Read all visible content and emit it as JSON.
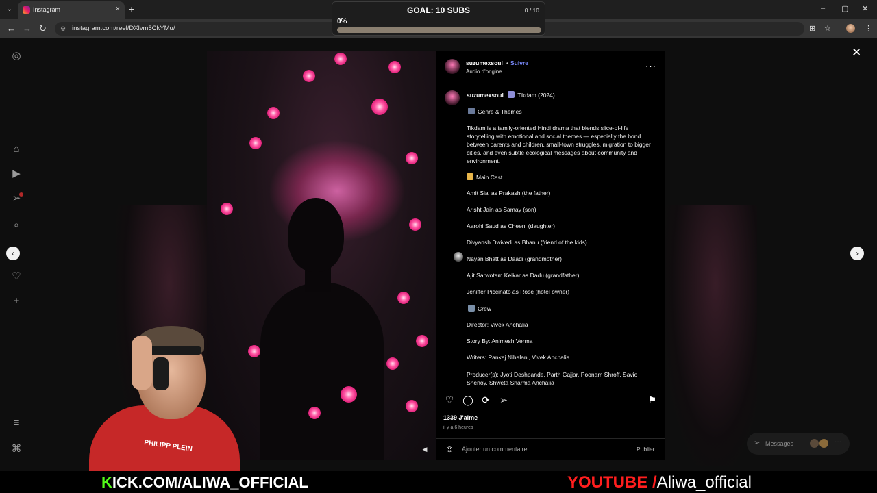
{
  "browser": {
    "tab_title": "Instagram",
    "tab_close": "×",
    "new_tab": "+",
    "url": "instagram.com/reel/DXlvm5CkYMu/",
    "window_controls": {
      "minimize": "–",
      "maximize": "▢",
      "close": "✕"
    }
  },
  "goal_widget": {
    "title": "GOAL: 10 SUBS",
    "count": "0 / 10",
    "percent_label": "0%",
    "progress": 0.0
  },
  "post": {
    "username": "suzumexsoul",
    "follow_label": "Suivre",
    "audio_label": "Audio d'origine",
    "more_label": "···",
    "caption": {
      "username": "suzumexsoul",
      "title": "Tikdam (2024)",
      "genre_heading": "Genre & Themes",
      "summary": "Tikdam is a family-oriented Hindi drama that blends slice-of-life storytelling with emotional and social themes — especially the bond between parents and children, small-town struggles, migration to bigger cities, and even subtle ecological messages about community and environment.",
      "cast_heading": "Main Cast",
      "cast": [
        "Amit Sial as Prakash (the father)",
        "Arisht Jain as Samay (son)",
        "Aarohi Saud as Cheeni (daughter)",
        "Divyansh Dwivedi as Bhanu (friend of the kids)",
        "Nayan Bhatt as Daadi (grandmother)",
        "Ajit Sarwotam Kelkar as Dadu (grandfather)",
        "Jeniffer Piccinato as Rose (hotel owner)"
      ],
      "crew_heading": "Crew",
      "crew": [
        "Director: Vivek Anchalia",
        "Story By: Animesh Verma",
        "Writers: Pankaj Nihalani, Vivek Anchalia",
        "Producer(s): Jyoti Deshpande, Parth Gajjar, Poonam Shroff, Savio Shenoy, Shweta Sharma Anchalia"
      ]
    },
    "likes": "1339 J'aime",
    "time_ago": "il y a 6 heures",
    "comment_placeholder": "Ajouter un commentaire...",
    "publish_label": "Publier"
  },
  "messages_label": "Messages",
  "banner": {
    "kick_k": "K",
    "kick_rest": "ICK.COM/ALIWA_OFFICIAL",
    "youtube_label": "YOUTUBE /",
    "youtube_name": "Aliwa_official"
  },
  "webcam_shirt_text": "PHILIPP PLEIN",
  "colors": {
    "follow": "#7b8cff",
    "kick_green": "#53fc18",
    "youtube_red": "#ff1e1e",
    "shirt": "#c62828"
  }
}
